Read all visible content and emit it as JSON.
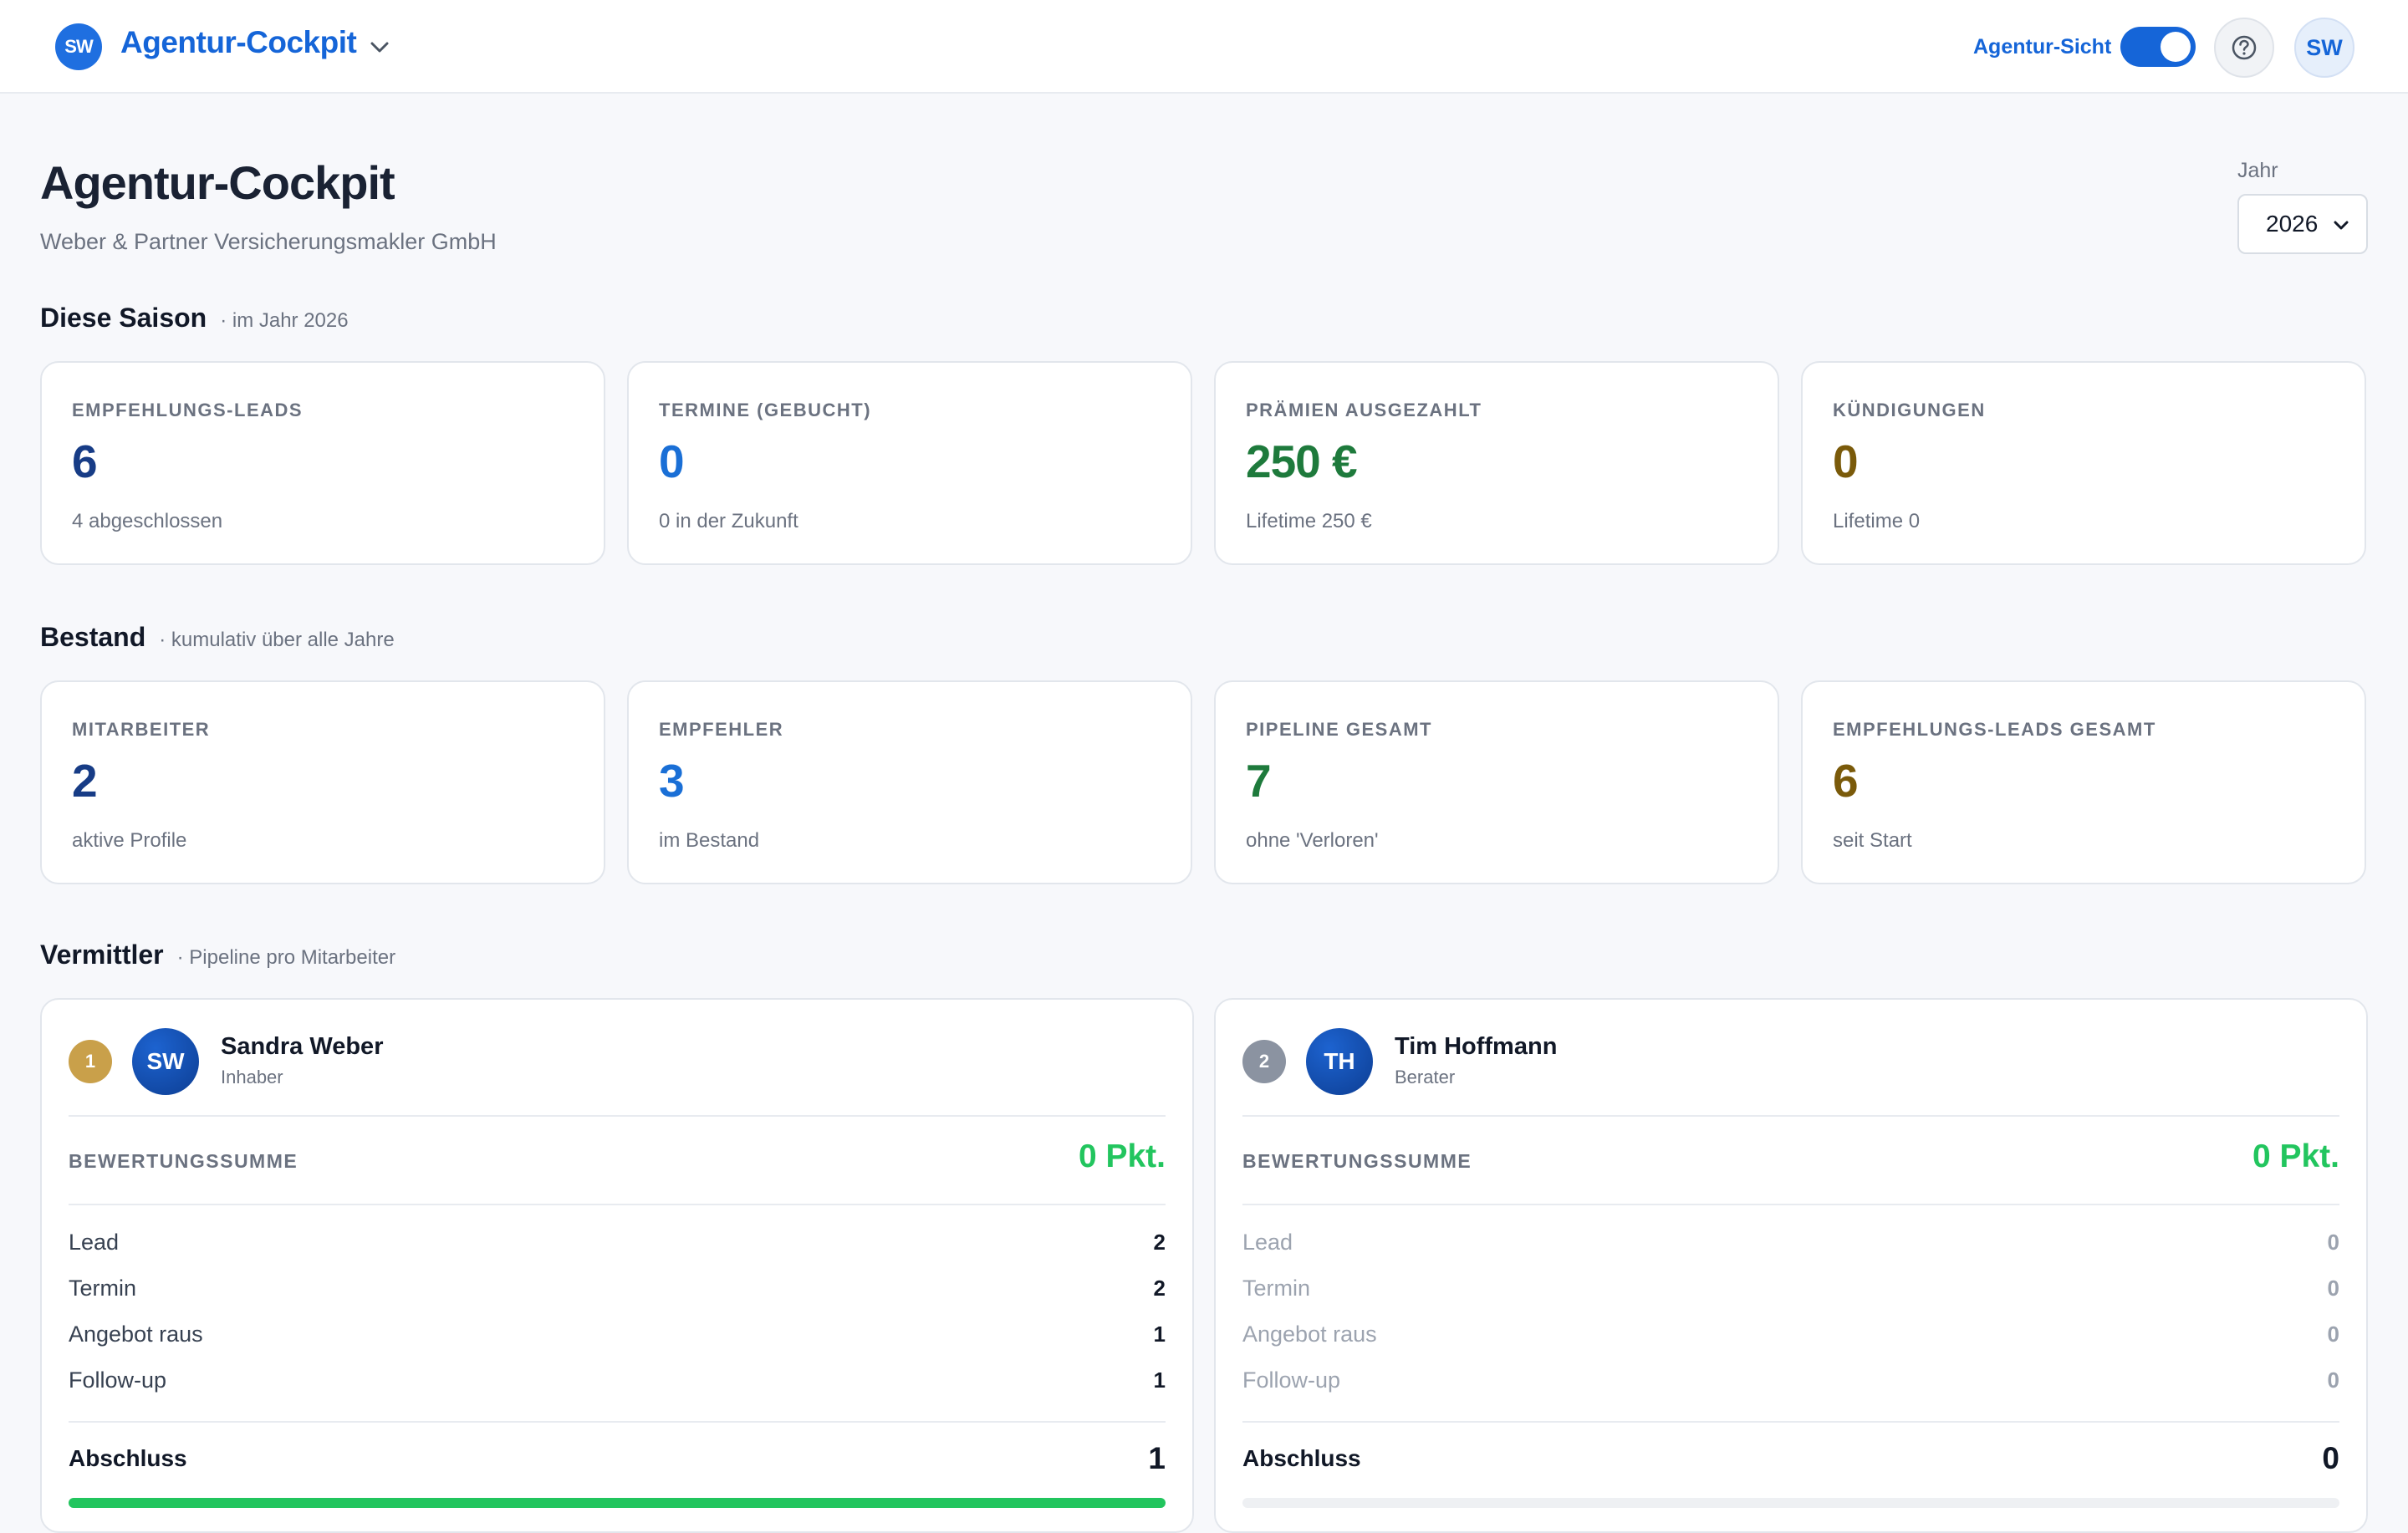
{
  "header": {
    "brand_initials": "SW",
    "title": "Agentur-Cockpit",
    "view_toggle_label": "Agentur-Sicht",
    "view_toggle_on": true,
    "help_icon": "question-circle-icon",
    "user_initials": "SW"
  },
  "page": {
    "title": "Agentur-Cockpit",
    "subtitle": "Weber & Partner Versicherungsmakler GmbH",
    "year_label": "Jahr",
    "year_value": "2026"
  },
  "colors": {
    "accent": "#1565d8",
    "dark_blue": "#173c86",
    "green": "#1e7a3c",
    "olive": "#7a5a0a",
    "success": "#22c55e"
  },
  "season": {
    "title": "Diese Saison",
    "subtitle": "· im Jahr 2026",
    "cards": [
      {
        "label": "EMPFEHLUNGS-LEADS",
        "value": "6",
        "sub": "4 abgeschlossen",
        "color": "#173c86"
      },
      {
        "label": "TERMINE (GEBUCHT)",
        "value": "0",
        "sub": "0 in der Zukunft",
        "color": "#1a6fd6"
      },
      {
        "label": "PRÄMIEN AUSGEZAHLT",
        "value": "250 €",
        "sub": "Lifetime 250 €",
        "color": "#1e7a3c"
      },
      {
        "label": "KÜNDIGUNGEN",
        "value": "0",
        "sub": "Lifetime 0",
        "color": "#7a5a0a"
      }
    ]
  },
  "inventory": {
    "title": "Bestand",
    "subtitle": "· kumulativ über alle Jahre",
    "cards": [
      {
        "label": "MITARBEITER",
        "value": "2",
        "sub": "aktive Profile",
        "color": "#173c86"
      },
      {
        "label": "EMPFEHLER",
        "value": "3",
        "sub": "im Bestand",
        "color": "#1a6fd6"
      },
      {
        "label": "PIPELINE GESAMT",
        "value": "7",
        "sub": "ohne 'Verloren'",
        "color": "#1e7a3c"
      },
      {
        "label": "EMPFEHLUNGS-LEADS GESAMT",
        "value": "6",
        "sub": "seit Start",
        "color": "#7a5a0a"
      }
    ]
  },
  "agents": {
    "title": "Vermittler",
    "subtitle": "· Pipeline pro Mitarbeiter",
    "items": [
      {
        "rank": "1",
        "rank_color": "#c9a04a",
        "initials": "SW",
        "name": "Sandra Weber",
        "role": "Inhaber",
        "score_label": "BEWERTUNGSSUMME",
        "score": "0 Pkt.",
        "stages": [
          {
            "label": "Lead",
            "value": "2"
          },
          {
            "label": "Termin",
            "value": "2"
          },
          {
            "label": "Angebot raus",
            "value": "1"
          },
          {
            "label": "Follow-up",
            "value": "1"
          }
        ],
        "closing_label": "Abschluss",
        "closing_value": "1",
        "progress": 1.0
      },
      {
        "rank": "2",
        "rank_color": "#8b93a1",
        "initials": "TH",
        "name": "Tim Hoffmann",
        "role": "Berater",
        "score_label": "BEWERTUNGSSUMME",
        "score": "0 Pkt.",
        "stages": [
          {
            "label": "Lead",
            "value": "0"
          },
          {
            "label": "Termin",
            "value": "0"
          },
          {
            "label": "Angebot raus",
            "value": "0"
          },
          {
            "label": "Follow-up",
            "value": "0"
          }
        ],
        "closing_label": "Abschluss",
        "closing_value": "0",
        "progress": 0.0
      }
    ]
  }
}
